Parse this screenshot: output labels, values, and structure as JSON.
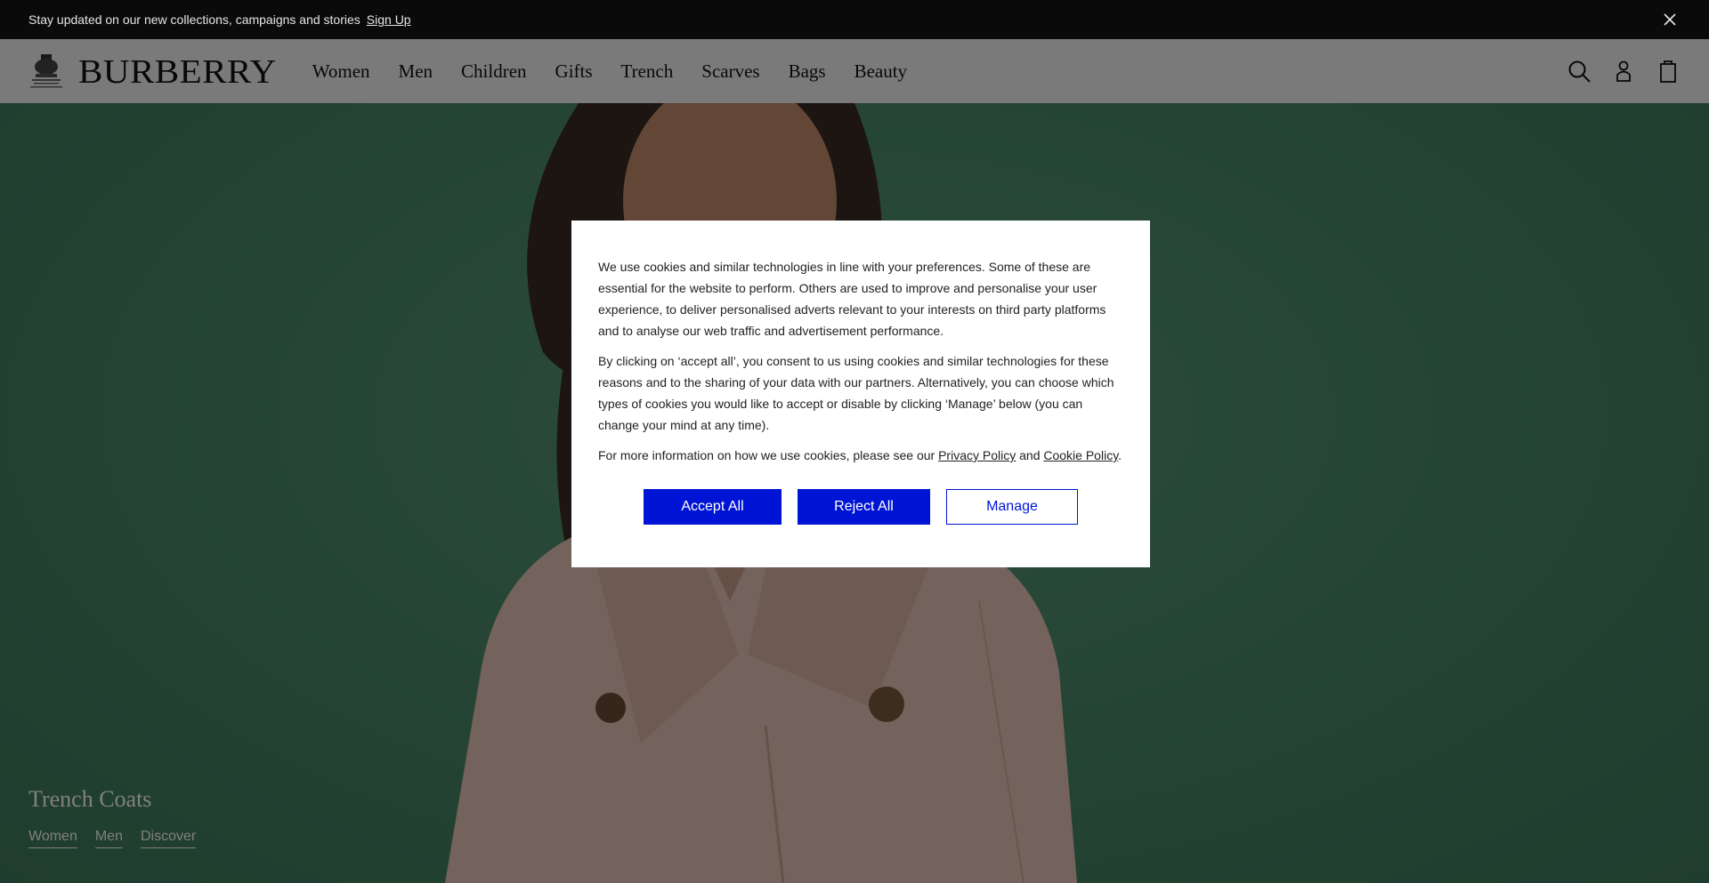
{
  "announcement": {
    "text": "Stay updated on our new collections, campaigns and stories",
    "signup_label": "Sign Up",
    "close_icon": "close-icon"
  },
  "header": {
    "brand": "BURBERRY",
    "nav": [
      "Women",
      "Men",
      "Children",
      "Gifts",
      "Trench",
      "Scarves",
      "Bags",
      "Beauty"
    ],
    "icons": [
      "search-icon",
      "account-icon",
      "bag-icon"
    ]
  },
  "hero": {
    "title": "Trench Coats",
    "links": [
      "Women",
      "Men",
      "Discover"
    ]
  },
  "cookie_modal": {
    "paragraph1": "We use cookies and similar technologies in line with your preferences. Some of these are essential for the website to perform. Others are used to improve and personalise your user experience, to deliver personalised adverts relevant to your interests on third party platforms and to analyse our web traffic and advertisement performance.",
    "paragraph2": "By clicking on ‘accept all’, you consent to us using cookies and similar technologies for these reasons and to the sharing of your data with our partners. Alternatively, you can choose which types of cookies you would like to accept or disable by clicking ‘Manage’ below (you can change your mind at any time).",
    "paragraph3_prefix": "For more information on how we use cookies, please see our ",
    "privacy_link": "Privacy Policy",
    "and_text": " and ",
    "cookie_link": "Cookie Policy",
    "period": ".",
    "accept_label": "Accept All",
    "reject_label": "Reject All",
    "manage_label": "Manage"
  },
  "colors": {
    "accent": "#0014d6",
    "announcement_bg": "#0a0a0a",
    "hero_bg": "#4c8b69"
  }
}
